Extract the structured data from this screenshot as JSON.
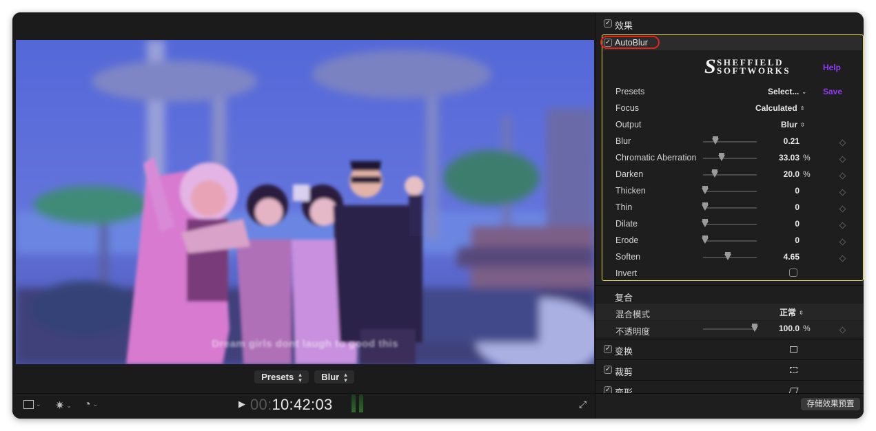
{
  "viewer": {
    "subtitle": "Dream girls dont laugh to good this",
    "controls": [
      {
        "label": "Presets"
      },
      {
        "label": "Blur"
      }
    ],
    "timecode_dim": "00:",
    "timecode_main": "10:42:03"
  },
  "inspector": {
    "effects_title": "效果",
    "effect_name": "AutoBlur",
    "logo_line1": "SHEFFIELD",
    "logo_line2": "SOFTWORKS",
    "help_label": "Help",
    "save_label": "Save",
    "params": [
      {
        "label": "Presets",
        "value": "Select...",
        "kind": "popup-down"
      },
      {
        "label": "Focus",
        "value": "Calculated",
        "kind": "popup"
      },
      {
        "label": "Output",
        "value": "Blur",
        "kind": "popup"
      },
      {
        "label": "Blur",
        "value": "0.21",
        "unit": "",
        "slider_level": 0.21
      },
      {
        "label": "Chromatic Aberration",
        "value": "33.03",
        "unit": "%",
        "slider_level": 0.33
      },
      {
        "label": "Darken",
        "value": "20.0",
        "unit": "%",
        "slider_level": 0.2
      },
      {
        "label": "Thicken",
        "value": "0",
        "unit": "",
        "slider_level": 0
      },
      {
        "label": "Thin",
        "value": "0",
        "unit": "",
        "slider_level": 0
      },
      {
        "label": "Dilate",
        "value": "0",
        "unit": "",
        "slider_level": 0
      },
      {
        "label": "Erode",
        "value": "0",
        "unit": "",
        "slider_level": 0
      },
      {
        "label": "Soften",
        "value": "4.65",
        "unit": "",
        "slider_level": 0.465
      },
      {
        "label": "Invert",
        "kind": "checkbox"
      }
    ],
    "composite_title": "复合",
    "blend_mode_label": "混合模式",
    "blend_mode_value": "正常",
    "opacity_label": "不透明度",
    "opacity_value": "100.0",
    "opacity_unit": "%",
    "opacity_level": 1.0,
    "transform_label": "变换",
    "crop_label": "裁剪",
    "distort_label": "变形",
    "save_preset_label": "存储效果预置"
  },
  "colors": {
    "highlight_box": "#e6d44a",
    "annotation_oval": "#e0241c",
    "plugin_link": "#8f3cf0"
  }
}
